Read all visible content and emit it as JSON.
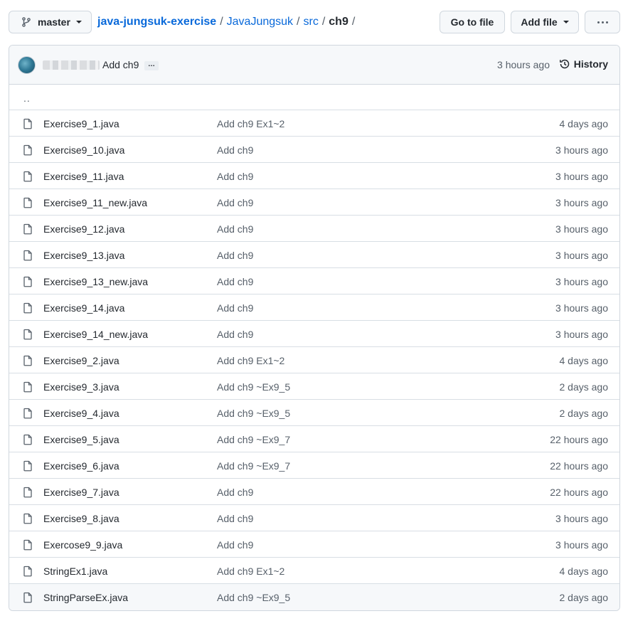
{
  "topbar": {
    "branch": "master",
    "go_to_file": "Go to file",
    "add_file": "Add file"
  },
  "breadcrumb": {
    "repo": "java-jungsuk-exercise",
    "sep": "/",
    "path1": "JavaJungsuk",
    "path2": "src",
    "current": "ch9"
  },
  "commit": {
    "message": "Add ch9",
    "ellipsis": "…",
    "time": "3 hours ago",
    "history": "History"
  },
  "parent_dir": "..",
  "files": [
    {
      "name": "Exercise9_1.java",
      "message": "Add ch9 Ex1~2",
      "time": "4 days ago"
    },
    {
      "name": "Exercise9_10.java",
      "message": "Add ch9",
      "time": "3 hours ago"
    },
    {
      "name": "Exercise9_11.java",
      "message": "Add ch9",
      "time": "3 hours ago"
    },
    {
      "name": "Exercise9_11_new.java",
      "message": "Add ch9",
      "time": "3 hours ago"
    },
    {
      "name": "Exercise9_12.java",
      "message": "Add ch9",
      "time": "3 hours ago"
    },
    {
      "name": "Exercise9_13.java",
      "message": "Add ch9",
      "time": "3 hours ago"
    },
    {
      "name": "Exercise9_13_new.java",
      "message": "Add ch9",
      "time": "3 hours ago"
    },
    {
      "name": "Exercise9_14.java",
      "message": "Add ch9",
      "time": "3 hours ago"
    },
    {
      "name": "Exercise9_14_new.java",
      "message": "Add ch9",
      "time": "3 hours ago"
    },
    {
      "name": "Exercise9_2.java",
      "message": "Add ch9 Ex1~2",
      "time": "4 days ago"
    },
    {
      "name": "Exercise9_3.java",
      "message": "Add ch9 ~Ex9_5",
      "time": "2 days ago"
    },
    {
      "name": "Exercise9_4.java",
      "message": "Add ch9 ~Ex9_5",
      "time": "2 days ago"
    },
    {
      "name": "Exercise9_5.java",
      "message": "Add ch9 ~Ex9_7",
      "time": "22 hours ago"
    },
    {
      "name": "Exercise9_6.java",
      "message": "Add ch9 ~Ex9_7",
      "time": "22 hours ago"
    },
    {
      "name": "Exercise9_7.java",
      "message": "Add ch9",
      "time": "22 hours ago"
    },
    {
      "name": "Exercise9_8.java",
      "message": "Add ch9",
      "time": "3 hours ago"
    },
    {
      "name": "Exercose9_9.java",
      "message": "Add ch9",
      "time": "3 hours ago"
    },
    {
      "name": "StringEx1.java",
      "message": "Add ch9 Ex1~2",
      "time": "4 days ago"
    },
    {
      "name": "StringParseEx.java",
      "message": "Add ch9 ~Ex9_5",
      "time": "2 days ago"
    }
  ]
}
